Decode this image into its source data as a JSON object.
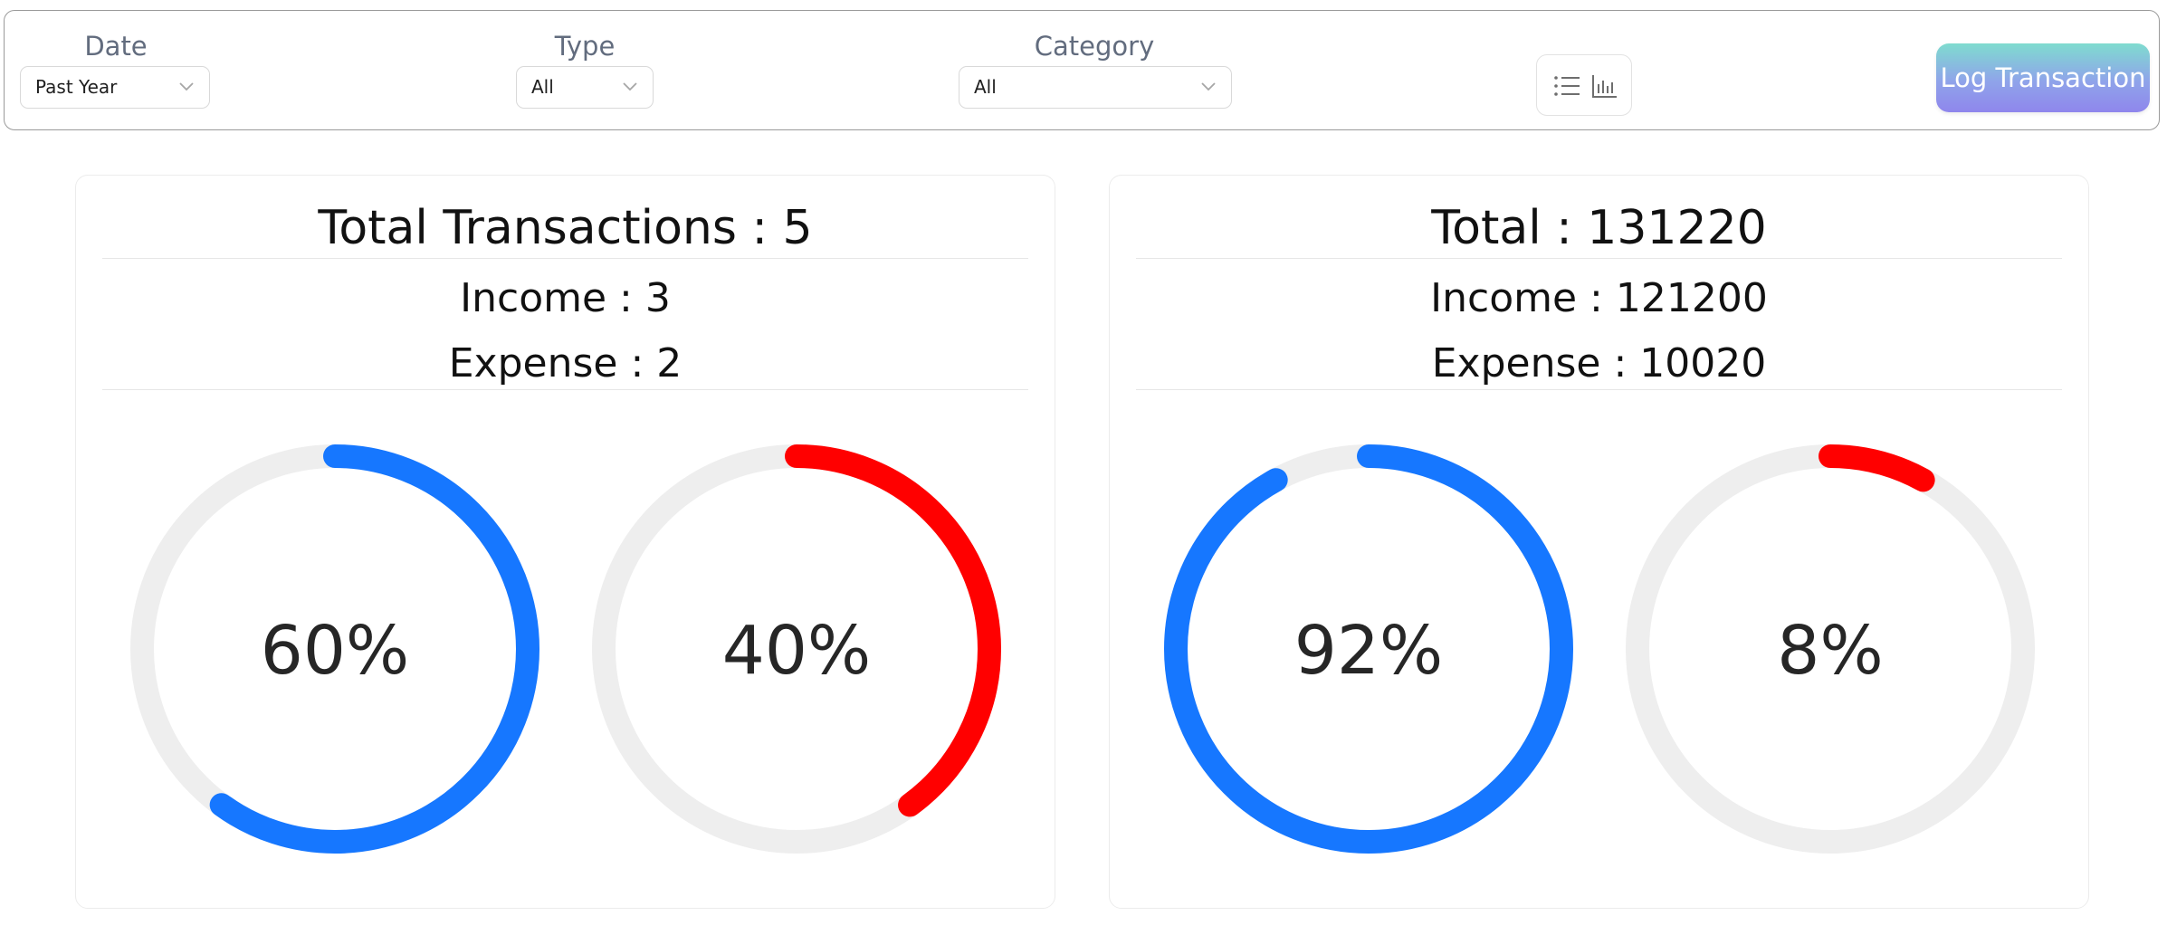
{
  "filters": {
    "date": {
      "label": "Date",
      "value": "Past Year"
    },
    "type": {
      "label": "Type",
      "value": "All"
    },
    "category": {
      "label": "Category",
      "value": "All"
    }
  },
  "view_toggle": {
    "list_icon": "list-icon",
    "chart_icon": "bar-chart-icon"
  },
  "log_button": {
    "label": "Log Transaction"
  },
  "colors": {
    "income": "#1677ff",
    "expense": "#ff0000",
    "track": "#eeeeee"
  },
  "count_card": {
    "title": "Total Transactions : 5",
    "income_line": "Income : 3",
    "expense_line": "Expense : 2",
    "income_gauge": {
      "percent": 60,
      "label": "60%"
    },
    "expense_gauge": {
      "percent": 40,
      "label": "40%"
    }
  },
  "amount_card": {
    "title": "Total : 131220",
    "income_line": "Income : 121200",
    "expense_line": "Expense : 10020",
    "income_gauge": {
      "percent": 92,
      "label": "92%"
    },
    "expense_gauge": {
      "percent": 8,
      "label": "8%"
    }
  }
}
